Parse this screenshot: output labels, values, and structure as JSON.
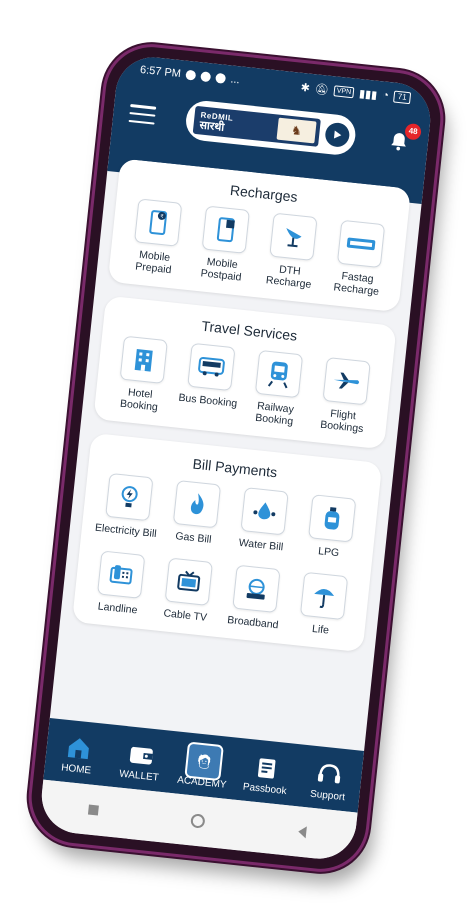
{
  "status_bar": {
    "time": "6:57 PM",
    "extra": "...",
    "vpn": "VPN",
    "battery": "71"
  },
  "header": {
    "logo_brand": "ReDMIL",
    "logo_sub": "सारथी",
    "notification_count": "48"
  },
  "sections": {
    "recharges": {
      "title": "Recharges",
      "items": [
        {
          "label": "Mobile Prepaid",
          "icon": "mobile-prepaid-icon"
        },
        {
          "label": "Mobile Postpaid",
          "icon": "mobile-postpaid-icon"
        },
        {
          "label": "DTH Recharge",
          "icon": "dth-dish-icon"
        },
        {
          "label": "Fastag Recharge",
          "icon": "fastag-icon"
        }
      ]
    },
    "travel": {
      "title": "Travel Services",
      "items": [
        {
          "label": "Hotel Booking",
          "icon": "hotel-icon"
        },
        {
          "label": "Bus Booking",
          "icon": "bus-icon"
        },
        {
          "label": "Railway Booking",
          "icon": "train-icon"
        },
        {
          "label": "Flight Bookings",
          "icon": "airplane-icon"
        }
      ]
    },
    "bills": {
      "title": "Bill Payments",
      "items": [
        {
          "label": "Electricity Bill",
          "icon": "bulb-icon"
        },
        {
          "label": "Gas Bill",
          "icon": "flame-icon"
        },
        {
          "label": "Water Bill",
          "icon": "water-drop-icon"
        },
        {
          "label": "LPG",
          "icon": "gas-cylinder-icon"
        },
        {
          "label": "Landline",
          "icon": "landline-phone-icon"
        },
        {
          "label": "Cable TV",
          "icon": "tv-icon"
        },
        {
          "label": "Broadband",
          "icon": "broadband-icon"
        },
        {
          "label": "Life",
          "icon": "umbrella-icon"
        }
      ]
    }
  },
  "bottom_nav": [
    {
      "label": "HOME",
      "icon": "home-icon"
    },
    {
      "label": "WALLET",
      "icon": "wallet-icon"
    },
    {
      "label": "ACADEMY",
      "icon": "academy-icon"
    },
    {
      "label": "Passbook",
      "icon": "passbook-icon"
    },
    {
      "label": "Support",
      "icon": "headset-icon"
    }
  ],
  "colors": {
    "primary": "#123b63",
    "accent": "#2e92d8",
    "badge": "#e5252a"
  }
}
